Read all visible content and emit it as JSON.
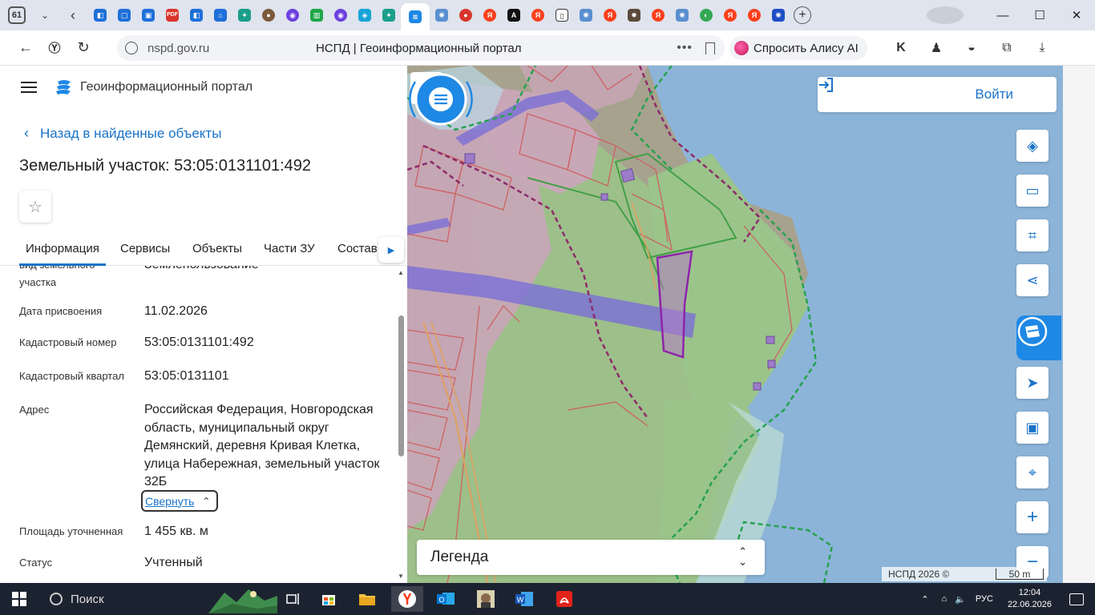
{
  "browser": {
    "tab_count": "61",
    "url": "nspd.gov.ru",
    "page_title": "НСПД | Геоинформационный портал",
    "alice_label": "Спросить Алису AI",
    "downloads_badge": "1"
  },
  "panel": {
    "portal_title": "Геоинформационный портал",
    "back_label": "Назад в найденные объекты",
    "parcel_title": "Земельный участок: 53:05:0131101:492",
    "tabs": [
      {
        "label": "Информация"
      },
      {
        "label": "Сервисы"
      },
      {
        "label": "Объекты"
      },
      {
        "label": "Части ЗУ"
      },
      {
        "label": "Состав"
      }
    ],
    "info": {
      "partial_label_line1": "вид земельного",
      "partial_label_line2": "участка",
      "partial_value": "Землепользование",
      "rows": [
        {
          "label": "Дата присвоения",
          "value": "11.02.2026"
        },
        {
          "label": "Кадастровый номер",
          "value": "53:05:0131101:492"
        },
        {
          "label": "Кадастровый квартал",
          "value": "53:05:0131101"
        },
        {
          "label": "Адрес",
          "value": "Российская Федерация, Новгородская область, муниципальный округ Демянский, деревня Кривая Клетка, улица Набережная, земельный участок 32Б"
        },
        {
          "label": "Площадь уточненная",
          "value": "1 455 кв. м"
        },
        {
          "label": "Статус",
          "value": "Учтенный"
        }
      ],
      "collapse_label": "Свернуть"
    }
  },
  "map": {
    "login_label": "Войти",
    "legend_label": "Легенда",
    "attribution": "НСПД 2026 ©",
    "scale_label": "50 m",
    "colors": {
      "water": "#8cb4d8",
      "green_zone": "#9bc48a",
      "pink_zone": "#c9a6b8",
      "purple_road": "#7b6fd6",
      "dashed_border": "#8e2b6a",
      "green_dashed": "#26a24f",
      "selected_parcel": "#8e24aa"
    }
  },
  "taskbar": {
    "search_placeholder": "Поиск",
    "lang": "РУС",
    "time": "12:04",
    "date": "22.06.2026"
  }
}
